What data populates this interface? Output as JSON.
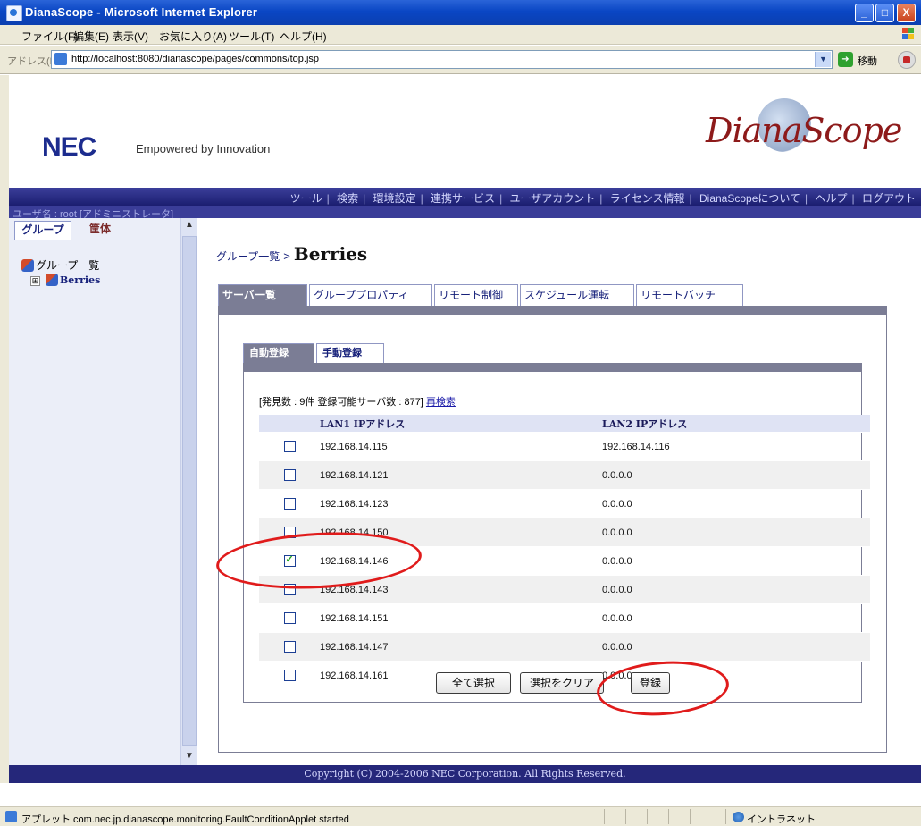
{
  "window": {
    "title": "DianaScope - Microsoft Internet Explorer",
    "minimize": "_",
    "maximize": "□",
    "close": "X"
  },
  "menu": [
    "ファイル(F)",
    "編集(E)",
    "表示(V)",
    "お気に入り(A)",
    "ツール(T)",
    "ヘルプ(H)"
  ],
  "address": {
    "label": "アドレス(D)",
    "url": "http://localhost:8080/dianascope/pages/commons/top.jsp",
    "go_label": "移動"
  },
  "banner": {
    "logo": "NEC",
    "tagline": "Empowered by Innovation",
    "product_logo": "DianaScope"
  },
  "nav": {
    "items": [
      "ツール",
      "検索",
      "環境設定",
      "連携サービス",
      "ユーザアカウント",
      "ライセンス情報",
      "DianaScopeについて",
      "ヘルプ",
      "ログアウト"
    ],
    "separator": "|",
    "user_line": "ユーザ名 : root [アドミニストレータ]"
  },
  "left_panel": {
    "tabs": [
      "グループ",
      "筐体"
    ],
    "tree": {
      "root": "グループ一覧",
      "child": "Berries",
      "expand": "⊞"
    }
  },
  "main": {
    "breadcrumb_parent": "グループ一覧",
    "breadcrumb_sep": ">",
    "breadcrumb_current": "Berries",
    "tabs": [
      "サーバ一覧",
      "グループプロパティ",
      "リモート制御",
      "スケジュール運転",
      "リモートバッチ"
    ],
    "subtabs": [
      "自動登録",
      "手動登録"
    ],
    "found_text": "[発見数 : 9件  登録可能サーバ数 : 877]",
    "rescan_link": "再検索",
    "table": {
      "headers": [
        "",
        "LAN1 IPアドレス",
        "LAN2 IPアドレス"
      ],
      "rows": [
        {
          "checked": false,
          "lan1": "192.168.14.115",
          "lan2": "192.168.14.116"
        },
        {
          "checked": false,
          "lan1": "192.168.14.121",
          "lan2": "0.0.0.0"
        },
        {
          "checked": false,
          "lan1": "192.168.14.123",
          "lan2": "0.0.0.0"
        },
        {
          "checked": false,
          "lan1": "192.168.14.150",
          "lan2": "0.0.0.0"
        },
        {
          "checked": true,
          "lan1": "192.168.14.146",
          "lan2": "0.0.0.0"
        },
        {
          "checked": false,
          "lan1": "192.168.14.143",
          "lan2": "0.0.0.0"
        },
        {
          "checked": false,
          "lan1": "192.168.14.151",
          "lan2": "0.0.0.0"
        },
        {
          "checked": false,
          "lan1": "192.168.14.147",
          "lan2": "0.0.0.0"
        },
        {
          "checked": false,
          "lan1": "192.168.14.161",
          "lan2": "0.0.0.0"
        }
      ]
    },
    "buttons": {
      "select_all": "全て選択",
      "clear_selection": "選択をクリア",
      "register": "登録"
    }
  },
  "footer": "Copyright (C) 2004-2006 NEC Corporation. All Rights Reserved.",
  "status": {
    "text": "アプレット com.nec.jp.dianascope.monitoring.FaultConditionApplet started",
    "zone": "イントラネット"
  },
  "colors": {
    "titlebar": "#0a46c4",
    "nav": "#25277a",
    "tab_active": "#7b7d95",
    "annotation": "#e01b1b"
  }
}
